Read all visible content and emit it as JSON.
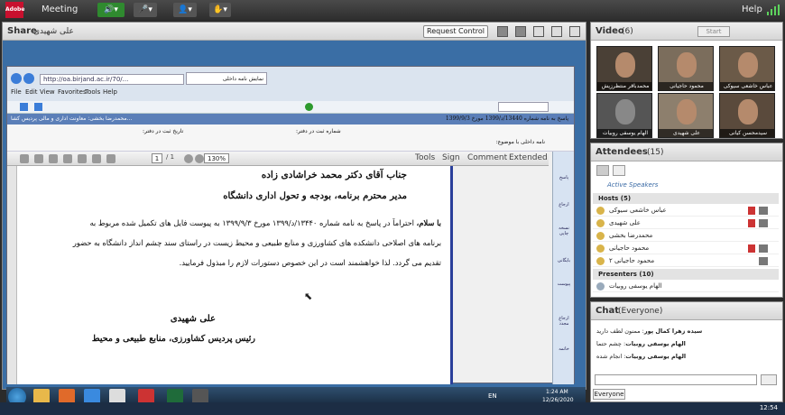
{
  "topbar": {
    "logo_text": "Adobe",
    "meeting_label": "Meeting",
    "help_label": "Help"
  },
  "share": {
    "title": "Share",
    "presenter_name": "علی شهیدی",
    "request_control": "Request Control",
    "browser": {
      "url": "http://oa.birjand.ac.ir/70/...",
      "tab_title": "نمایش نامه داخلی",
      "menu": [
        "File",
        "Edit",
        "View",
        "Favorites",
        "Tools",
        "Help"
      ],
      "blue_bar_right": "پاسخ به نامه شماره 13440/د/1399 مورخ 1399/9/3",
      "blue_bar_left": "محمدرضا بخشی: معاونت اداری و مالی پردیس کشا...",
      "form_labels": {
        "date": "تاریخ ثبت در دفتر:",
        "number": "شماره ثبت در دفتر:",
        "subject": "نامه داخلی با موضوع:"
      },
      "pdf_toolbar": {
        "page": "1",
        "total": "/ 1",
        "zoom": "130%",
        "tools": "Tools",
        "sign": "Sign",
        "comment": "Comment",
        "extended": "Extended"
      },
      "right_nav": [
        "پاسخ",
        "ارجاع",
        "نسخه چاپی",
        "بایگانی",
        "پیوست",
        "ارجاع مجدد",
        "خاتمه"
      ]
    },
    "letter": {
      "salutation": "جناب آقای دکتر محمد خراشادی زاده",
      "position": "مدیر محترم برنامه، بودجه و تحول اداری دانشگاه",
      "body_line1_bold": "با سلام،",
      "body_line1": " احتراماً در پاسخ به نامه شماره ۱۳۴۴۰/د/۱۳۹۹ مورخ ۱۳۹۹/۹/۳ به پیوست فایل های تکمیل شده مربوط به",
      "body_line2": "برنامه های اصلاحی دانشکده های کشاورزی و منابع طبیعی و محیط زیست در راستای سند چشم انداز دانشگاه به حضور",
      "body_line3": "تقدیم می گردد. لذا خواهشمند است در این خصوص دستورات لازم را مبذول فرمایید.",
      "signer_name": "علی شهیدی",
      "signer_title": "رئیس پردیس کشاورزی، منابع طبیعی و محیط"
    },
    "taskbar": {
      "lang": "EN",
      "time": "1:24 AM",
      "date": "12/26/2020"
    }
  },
  "video": {
    "title": "Video",
    "count": "(6)",
    "start_label": "Start",
    "tiles": [
      "عباس خاشعی سیوکی",
      "محمود حاجیانی",
      "محمدباقر منتظرزیش",
      "سیدمحسن کیانی",
      "علی شهیدی",
      "الهام یوسفی روبیات"
    ]
  },
  "attendees": {
    "title": "Attendees",
    "count": "(15)",
    "active_speakers": "Active Speakers",
    "hosts_label": "Hosts (5)",
    "hosts": [
      "عباس خاشعی سیوکی",
      "علی شهیدی",
      "محمدرضا بخشی",
      "محمود حاجیانی",
      "محمود حاجیانی ۲"
    ],
    "presenters_label": "Presenters (10)",
    "presenters": [
      "الهام یوسفی روبیات"
    ]
  },
  "chat": {
    "title": "Chat",
    "scope": "(Everyone)",
    "messages": [
      {
        "author": "سیده زهرا کمال پور",
        "text": "ممنون لطف دارید"
      },
      {
        "author": "الهام یوسفی روبیات",
        "text": "چشم حتما"
      },
      {
        "author": "الهام یوسفی روبیات",
        "text": "انجام شده"
      }
    ],
    "everyone_tab": "Everyone"
  },
  "os": {
    "time": "12:54"
  }
}
